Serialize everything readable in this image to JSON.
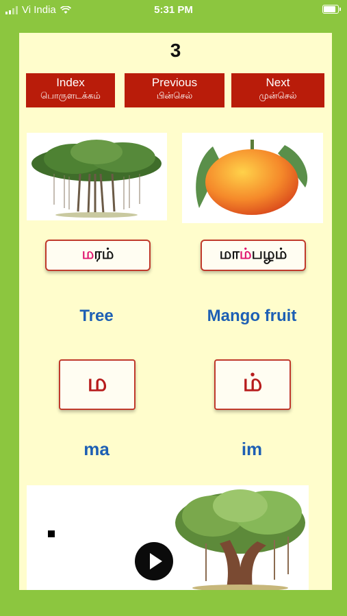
{
  "status_bar": {
    "carrier": "Vi India",
    "time": "5:31 PM",
    "battery_level": 0.9
  },
  "page_number": "3",
  "nav": {
    "index": {
      "en": "Index",
      "ta": "பொருளடக்கம்"
    },
    "previous": {
      "en": "Previous",
      "ta": "பின்செல்"
    },
    "next": {
      "en": "Next",
      "ta": "முன்செல்"
    }
  },
  "cards": [
    {
      "image": "banyan-tree",
      "word_highlight": "ம",
      "word_rest": "ரம்",
      "english": "Tree",
      "letter": "ம",
      "roman": "ma"
    },
    {
      "image": "mango-fruit",
      "word_prefix": "மா",
      "word_highlight": "ம்",
      "word_rest": "பழம்",
      "english": "Mango fruit",
      "letter": "ம்",
      "roman": "im"
    }
  ],
  "colors": {
    "background": "#8cc63f",
    "panel": "#fffdcc",
    "nav_button": "#b91c0a",
    "english_text": "#1d5fb4",
    "letter_text": "#b71c1c",
    "highlight": "#e0156f"
  }
}
